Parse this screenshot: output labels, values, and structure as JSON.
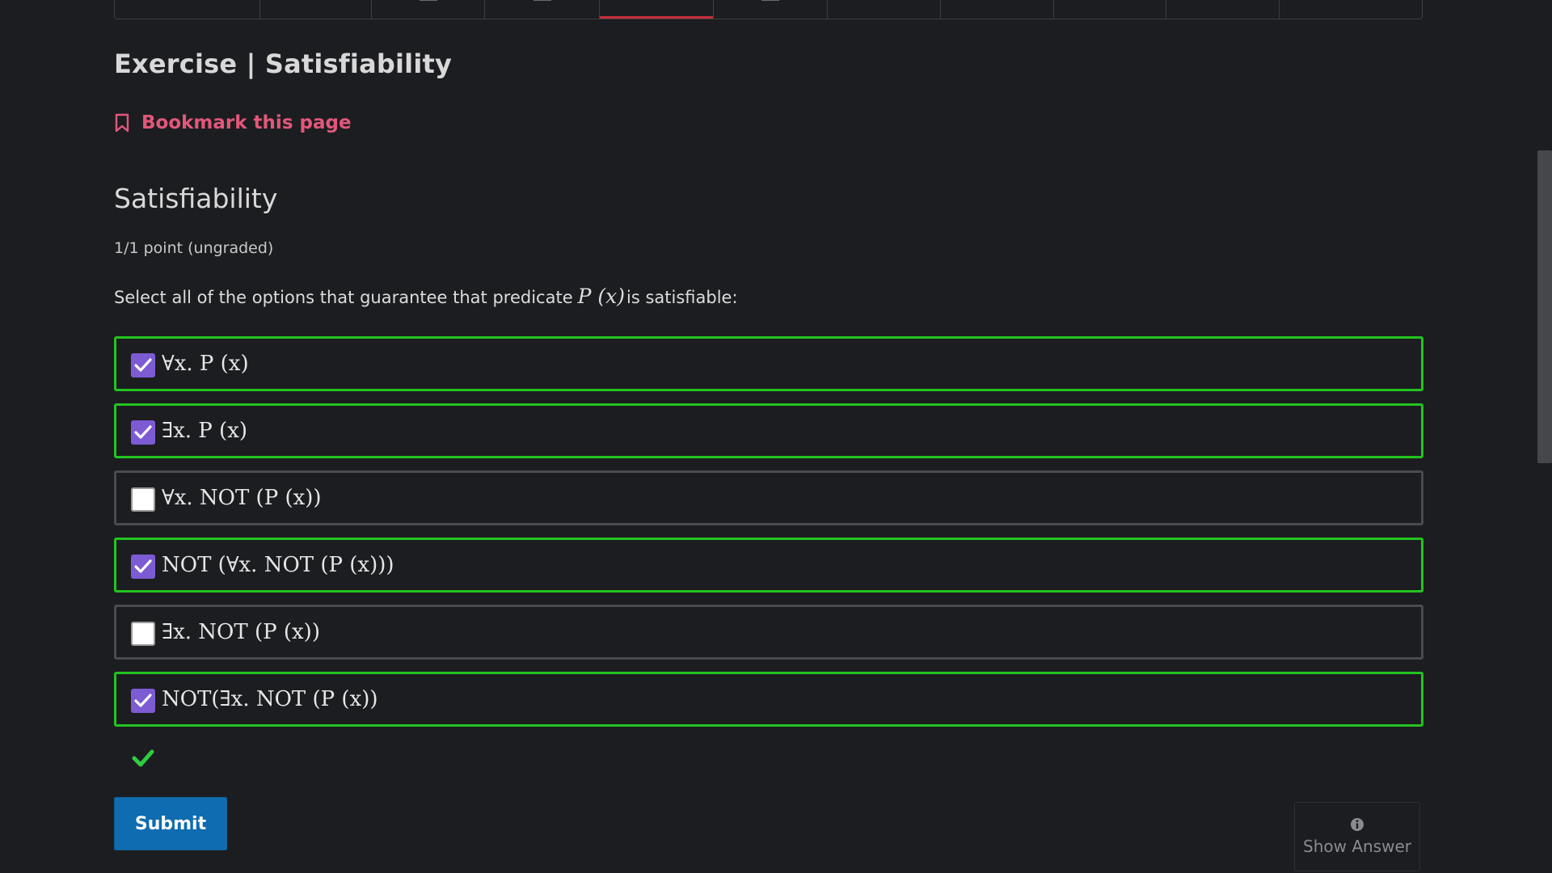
{
  "course_nav": {
    "tabs": [
      {
        "id": "seq-1",
        "active": false
      },
      {
        "id": "seq-2",
        "active": false
      },
      {
        "id": "seq-3",
        "active": false
      },
      {
        "id": "seq-4",
        "active": false
      },
      {
        "id": "seq-5",
        "active": true
      },
      {
        "id": "seq-6",
        "active": false
      },
      {
        "id": "seq-7",
        "active": false
      },
      {
        "id": "seq-8",
        "active": false
      },
      {
        "id": "seq-9",
        "active": false
      },
      {
        "id": "seq-10",
        "active": false
      },
      {
        "id": "seq-11",
        "active": false
      }
    ]
  },
  "unit": {
    "title": "Exercise | Satisfiability",
    "bookmark_label": "Bookmark this page"
  },
  "problem": {
    "title": "Satisfiability",
    "points": "1/1 point (ungraded)",
    "prompt_before": "Select all of the options that guarantee that predicate",
    "prompt_math": "P (x)",
    "prompt_after": "is satisfiable:",
    "options": [
      {
        "label": "∀x. P (x)",
        "checked": true,
        "correct": true
      },
      {
        "label": "∃x. P (x)",
        "checked": true,
        "correct": true
      },
      {
        "label": "∀x. NOT (P (x))",
        "checked": false,
        "correct": false
      },
      {
        "label": "NOT (∀x. NOT (P (x)))",
        "checked": true,
        "correct": true
      },
      {
        "label": "∃x. NOT (P (x))",
        "checked": false,
        "correct": false
      },
      {
        "label": "NOT(∃x. NOT (P (x))",
        "checked": true,
        "correct": true
      }
    ],
    "submit_label": "Submit",
    "show_answer_label": "Show Answer"
  },
  "colors": {
    "background": "#1c1d20",
    "correct_border": "#22c41f",
    "checkbox_checked": "#7d5bd3",
    "bookmark": "#e2577a",
    "submit": "#0f6cb0"
  }
}
